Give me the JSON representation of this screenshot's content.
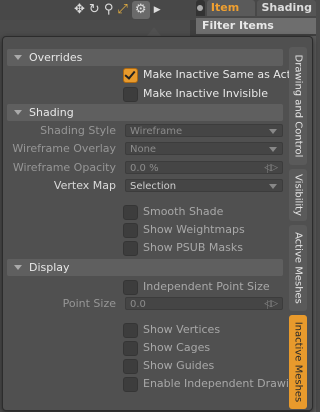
{
  "toolbar": {
    "icons": [
      "move-icon",
      "rotate-icon",
      "zoom-icon",
      "fit-icon",
      "gear-icon",
      "play-icon"
    ]
  },
  "tabs": [
    {
      "label": "Item List",
      "active": true
    },
    {
      "label": "Shading",
      "active": false
    }
  ],
  "filter_label": "Filter Items",
  "sections": {
    "overrides": "Overrides",
    "shading": "Shading",
    "display": "Display"
  },
  "overrides": {
    "make_inactive_same": {
      "label": "Make Inactive Same as Active",
      "checked": true
    },
    "make_inactive_invisible": {
      "label": "Make Inactive Invisible",
      "checked": false
    }
  },
  "shading": {
    "style_label": "Shading Style",
    "style_value": "Wireframe",
    "overlay_label": "Wireframe Overlay",
    "overlay_value": "None",
    "opacity_label": "Wireframe Opacity",
    "opacity_value": "0.0 %",
    "vertex_map_label": "Vertex Map",
    "vertex_map_value": "Selection",
    "smooth_shade": "Smooth Shade",
    "show_weightmaps": "Show Weightmaps",
    "show_psub_masks": "Show PSUB Masks"
  },
  "display": {
    "independent_point_size": "Independent Point Size",
    "point_size_label": "Point Size",
    "point_size_value": "0.0",
    "show_vertices": "Show Vertices",
    "show_cages": "Show Cages",
    "show_guides": "Show Guides",
    "enable_independent_drawing": "Enable Independent Drawing"
  },
  "side_tabs": [
    {
      "label": "Drawing and Control",
      "active": false
    },
    {
      "label": "Visibility",
      "active": false
    },
    {
      "label": "Active Meshes",
      "active": false
    },
    {
      "label": "Inactive Meshes",
      "active": true
    }
  ],
  "colors": {
    "accent": "#e89a2c",
    "panel": "#505050",
    "section": "#5f5f5f"
  }
}
